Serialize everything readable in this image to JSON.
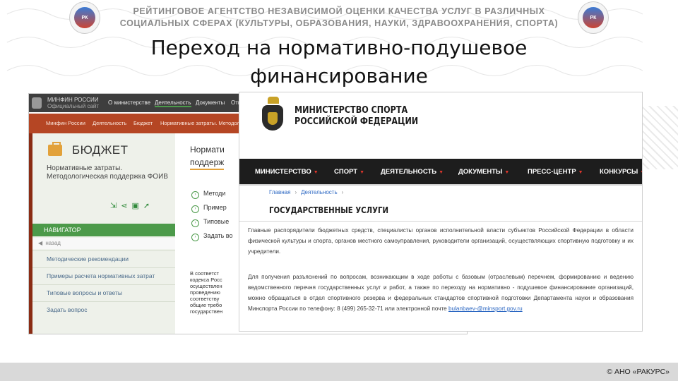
{
  "header": {
    "agency_line1": "РЕЙТИНГОВОЕ АГЕНТСТВО НЕЗАВИСИМОЙ ОЦЕНКИ КАЧЕСТВА УСЛУГ В РАЗЛИЧНЫХ",
    "agency_line2": "СОЦИАЛЬНЫХ СФЕРАХ (КУЛЬТУРЫ, ОБРАЗОВАНИЯ, НАУКИ, ЗДРАВООХРАНЕНИЯ, СПОРТА)",
    "title_line1": "Переход на нормативно-подушевое",
    "title_line2": "финансирование"
  },
  "minfin": {
    "brand_line1": "МИНФИН РОССИИ",
    "brand_line2": "Официальный сайт",
    "menu": [
      "О министерстве",
      "Деятельность",
      "Документы",
      "Отк"
    ],
    "crumbs": [
      "Минфин России",
      "Деятельность",
      "Бюджет",
      "Нормативные затраты. Методол"
    ],
    "section_title": "БЮДЖЕТ",
    "section_sub": "Нормативные затраты. Методологическая поддержка ФОИВ",
    "navigator": "НАВИГАТОР",
    "back": "назад",
    "nav_items": [
      "Методические рекомендации",
      "Примеры расчета нормативных затрат",
      "Типовые вопросы и ответы",
      "Задать вопрос"
    ],
    "main_heading_1": "Нормати",
    "main_heading_2": "поддерж",
    "list": [
      "Методи",
      "Пример",
      "Типовые",
      "Задать во"
    ],
    "fragment": "В соответст\nкодекса Росс\nосуществлен\nпроведению\nсоответству\nобщие требо\nгосударствен"
  },
  "minsport": {
    "title_line1": "МИНИСТЕРСТВО СПОРТА",
    "title_line2": "РОССИЙСКОЙ ФЕДЕРАЦИИ",
    "nav": [
      "МИНИСТЕРСТВО",
      "СПОРТ",
      "ДЕЯТЕЛЬНОСТЬ",
      "ДОКУМЕНТЫ",
      "ПРЕСС-ЦЕНТР",
      "КОНКУРСЫ"
    ],
    "crumb_home": "Главная",
    "crumb_activity": "Деятельность",
    "page_title": "ГОСУДАРСТВЕННЫЕ УСЛУГИ",
    "para1": "Главные распорядители бюджетных средств, специалисты органов исполнительной власти субъектов Российской Федерации в области физической культуры и спорта, органов местного самоуправления, руководители организаций, осуществляющих спортивную подготовку и их учредители.",
    "para2": "Для получения разъяснений по вопросам, возникающим в ходе работы с базовым (отраслевым) перечнем, формированию и ведению ведомственного перечня государственных услуг и работ, а также по переходу на нормативно - подушевое финансирование организаций, можно обращаться в отдел спортивного резерва и федеральных стандартов спортивной подготовки Департамента науки и образования Минспорта России по телефону: 8 (499) 265-32-71 или электронной почте",
    "email": "bulanbaev-@minsport.gov.ru"
  },
  "footer": {
    "copyright": "© АНО «РАКУРС»"
  }
}
